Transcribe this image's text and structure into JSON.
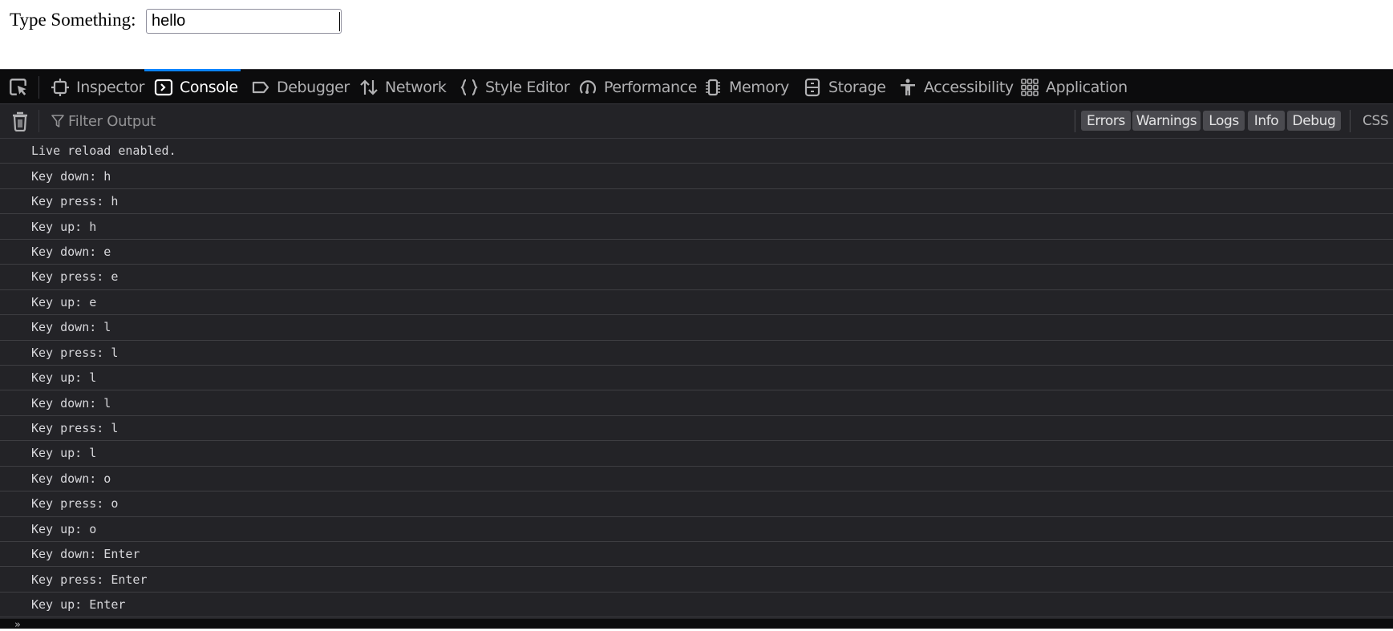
{
  "page": {
    "label": "Type Something:",
    "input_value": "hello"
  },
  "devtools": {
    "tabs": [
      {
        "label": "Inspector",
        "icon": "inspector-icon",
        "active": false
      },
      {
        "label": "Console",
        "icon": "console-icon",
        "active": true
      },
      {
        "label": "Debugger",
        "icon": "debugger-icon",
        "active": false
      },
      {
        "label": "Network",
        "icon": "network-icon",
        "active": false
      },
      {
        "label": "Style Editor",
        "icon": "style-editor-icon",
        "active": false
      },
      {
        "label": "Performance",
        "icon": "performance-icon",
        "active": false
      },
      {
        "label": "Memory",
        "icon": "memory-icon",
        "active": false
      },
      {
        "label": "Storage",
        "icon": "storage-icon",
        "active": false
      },
      {
        "label": "Accessibility",
        "icon": "accessibility-icon",
        "active": false
      },
      {
        "label": "Application",
        "icon": "application-icon",
        "active": false
      }
    ],
    "accent_color": "#0a84ff",
    "toolbar": {
      "filter_placeholder": "Filter Output",
      "filters": [
        "Errors",
        "Warnings",
        "Logs",
        "Info",
        "Debug"
      ],
      "css_label": "CSS"
    },
    "console_messages": [
      "Live reload enabled.",
      "Key down: h",
      "Key press: h",
      "Key up: h",
      "Key down: e",
      "Key press: e",
      "Key up: e",
      "Key down: l",
      "Key press: l",
      "Key up: l",
      "Key down: l",
      "Key press: l",
      "Key up: l",
      "Key down: o",
      "Key press: o",
      "Key up: o",
      "Key down: Enter",
      "Key press: Enter",
      "Key up: Enter"
    ],
    "input_prompt": "»"
  }
}
